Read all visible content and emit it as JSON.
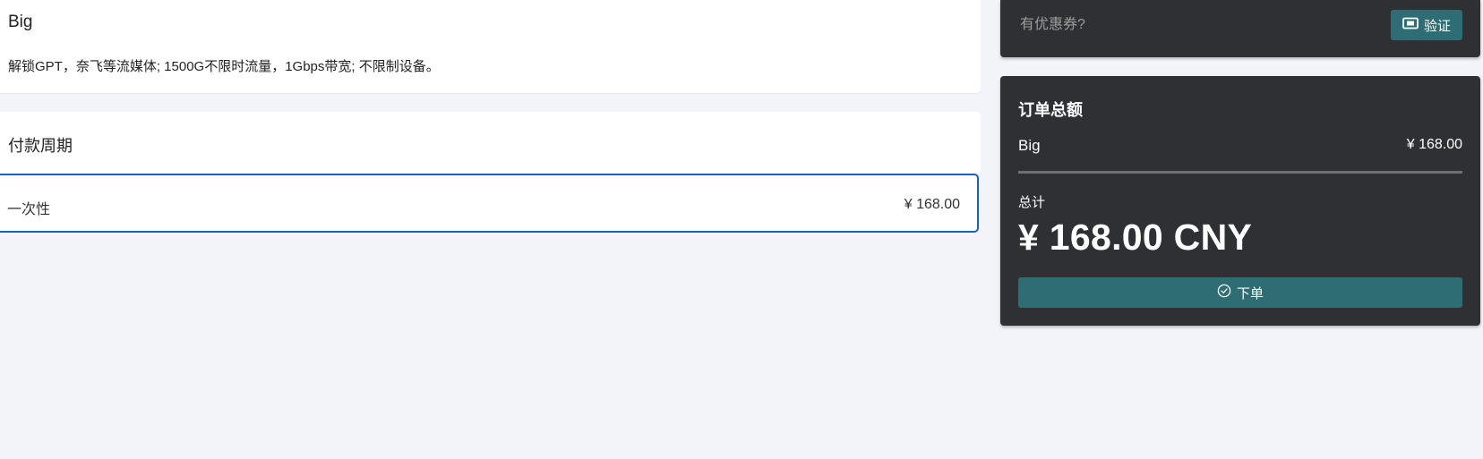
{
  "plan": {
    "name": "Big",
    "description": "解锁GPT，奈飞等流媒体; 1500G不限时流量，1Gbps带宽; 不限制设备。"
  },
  "payment_period": {
    "title": "付款周期",
    "options": [
      {
        "label": "一次性",
        "price": "¥ 168.00",
        "selected": true
      }
    ]
  },
  "coupon": {
    "placeholder": "有优惠券?",
    "verify_label": "验证",
    "icon": "ticket-icon"
  },
  "order_summary": {
    "title": "订单总额",
    "line_items": [
      {
        "name": "Big",
        "price": "¥ 168.00"
      }
    ],
    "total_label": "总计",
    "total_amount": "¥ 168.00 CNY",
    "submit_label": "下单",
    "submit_icon": "check-circle-icon"
  },
  "colors": {
    "page_background": "#f3f4f9",
    "dark_card": "#2e3034",
    "accent_button": "#2f6d74",
    "selected_border": "#1d5fc2"
  }
}
